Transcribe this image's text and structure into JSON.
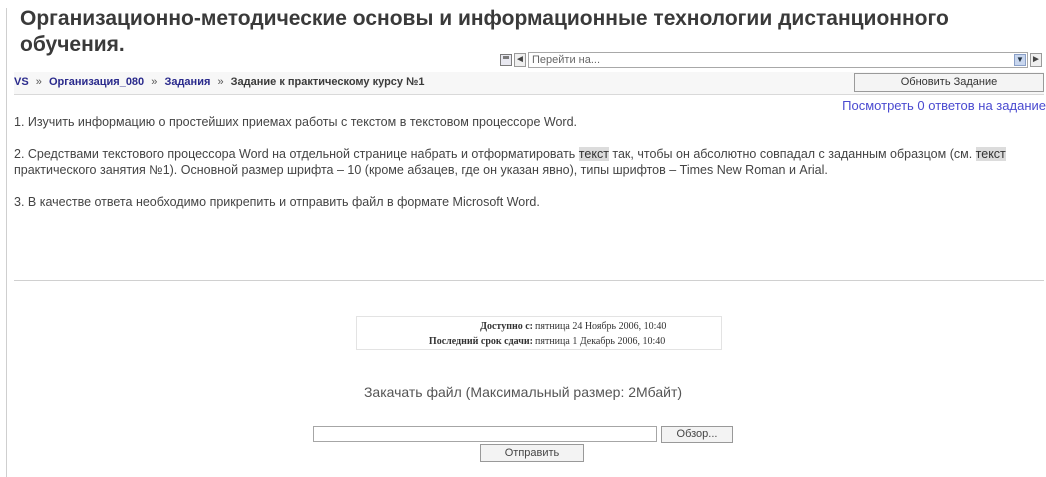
{
  "page": {
    "title": "Организационно-методические основы и информационные технологии дистанционного обучения."
  },
  "jump": {
    "prev_label": "◄",
    "placeholder": "Перейти на...",
    "next_label": "►",
    "icons": {
      "save": "floppy-icon",
      "dropdown": "chevron-down-icon"
    }
  },
  "navbar": {
    "breadcrumb": [
      {
        "label": "VS"
      },
      {
        "label": "Организация_080"
      },
      {
        "label": "Задания"
      }
    ],
    "current": "Задание к практическому курсу №1",
    "separator": "»",
    "update_button": "Обновить Задание"
  },
  "view_answers": "Посмотреть 0 ответов на задание",
  "task": {
    "p1": "1. Изучить информацию о простейших приемах работы с текстом в текстовом процессоре Word.",
    "p2_a": "2. Средствами текстового процессора Word на отдельной странице набрать и отформатировать ",
    "p2_hl1": "текст",
    "p2_b": " так, чтобы он абсолютно совпадал с заданным образцом (см. ",
    "p2_hl2": "текст",
    "p2_c": " практического занятия №1). Основной размер шрифта – 10 (кроме абзацев, где он указан явно), типы шрифтов – Times New Roman и Arial.",
    "p3": "3. В качестве ответа необходимо прикрепить и отправить файл в формате Microsoft Word."
  },
  "dates": {
    "available_label": "Доступно с:",
    "available_value": "пятница 24 Ноябрь 2006, 10:40",
    "due_label": "Последний срок сдачи:",
    "due_value": "пятница 1 Декабрь 2006, 10:40"
  },
  "upload": {
    "title": "Закачать файл (Максимальный размер: 2Мбайт)",
    "browse_button": "Обзор...",
    "submit_button": "Отправить"
  }
}
